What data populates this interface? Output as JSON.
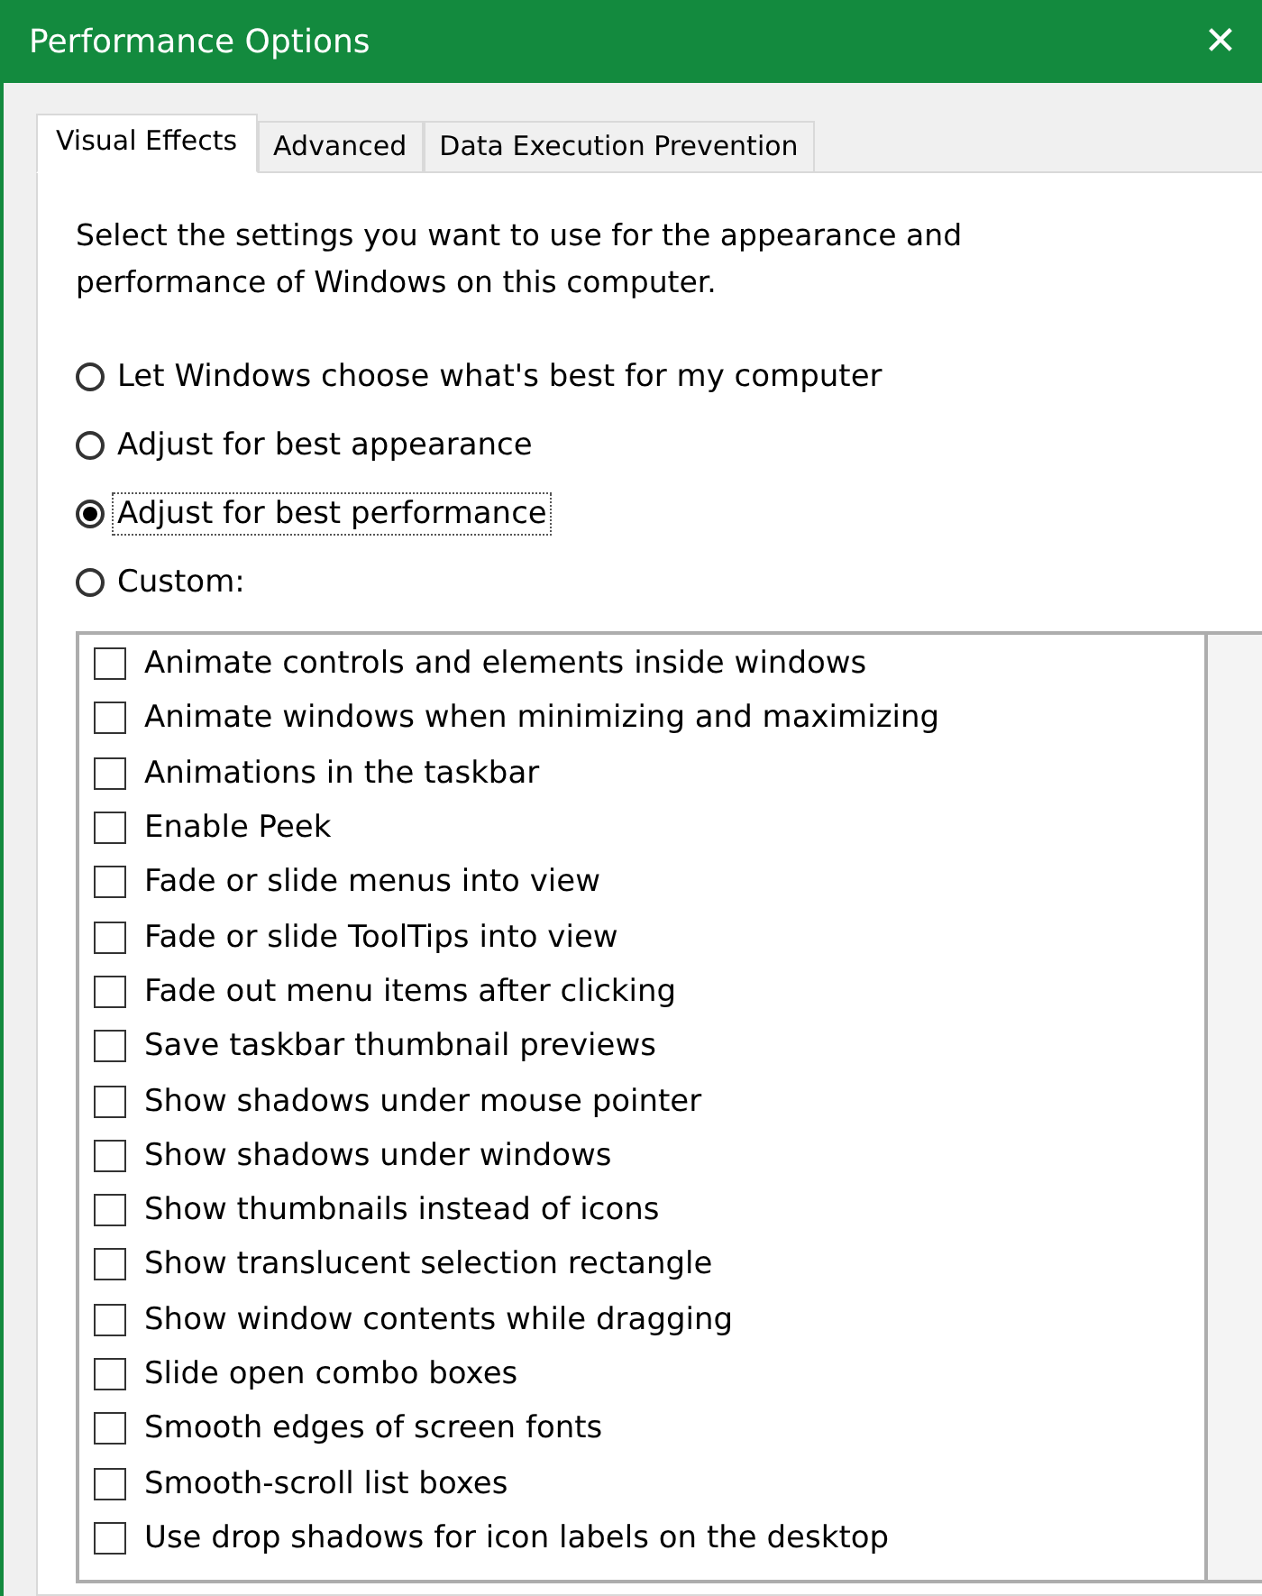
{
  "window": {
    "title": "Performance Options",
    "close": "✕"
  },
  "tabs": [
    {
      "label": "Visual Effects",
      "selected": true
    },
    {
      "label": "Advanced",
      "selected": false
    },
    {
      "label": "Data Execution Prevention",
      "selected": false
    }
  ],
  "intro": "Select the settings you want to use for the appearance and performance of Windows on this computer.",
  "options": [
    {
      "label": "Let Windows choose what's best for my computer",
      "selected": false
    },
    {
      "label": "Adjust for best appearance",
      "selected": false
    },
    {
      "label": "Adjust for best performance",
      "selected": true
    },
    {
      "label": "Custom:",
      "selected": false
    }
  ],
  "effects": [
    {
      "label": "Animate controls and elements inside windows",
      "checked": false
    },
    {
      "label": "Animate windows when minimizing and maximizing",
      "checked": false
    },
    {
      "label": "Animations in the taskbar",
      "checked": false
    },
    {
      "label": "Enable Peek",
      "checked": false
    },
    {
      "label": "Fade or slide menus into view",
      "checked": false
    },
    {
      "label": "Fade or slide ToolTips into view",
      "checked": false
    },
    {
      "label": "Fade out menu items after clicking",
      "checked": false
    },
    {
      "label": "Save taskbar thumbnail previews",
      "checked": false
    },
    {
      "label": "Show shadows under mouse pointer",
      "checked": false
    },
    {
      "label": "Show shadows under windows",
      "checked": false
    },
    {
      "label": "Show thumbnails instead of icons",
      "checked": false
    },
    {
      "label": "Show translucent selection rectangle",
      "checked": false
    },
    {
      "label": "Show window contents while dragging",
      "checked": false
    },
    {
      "label": "Slide open combo boxes",
      "checked": false
    },
    {
      "label": "Smooth edges of screen fonts",
      "checked": false
    },
    {
      "label": "Smooth-scroll list boxes",
      "checked": false
    },
    {
      "label": "Use drop shadows for icon labels on the desktop",
      "checked": false
    }
  ]
}
